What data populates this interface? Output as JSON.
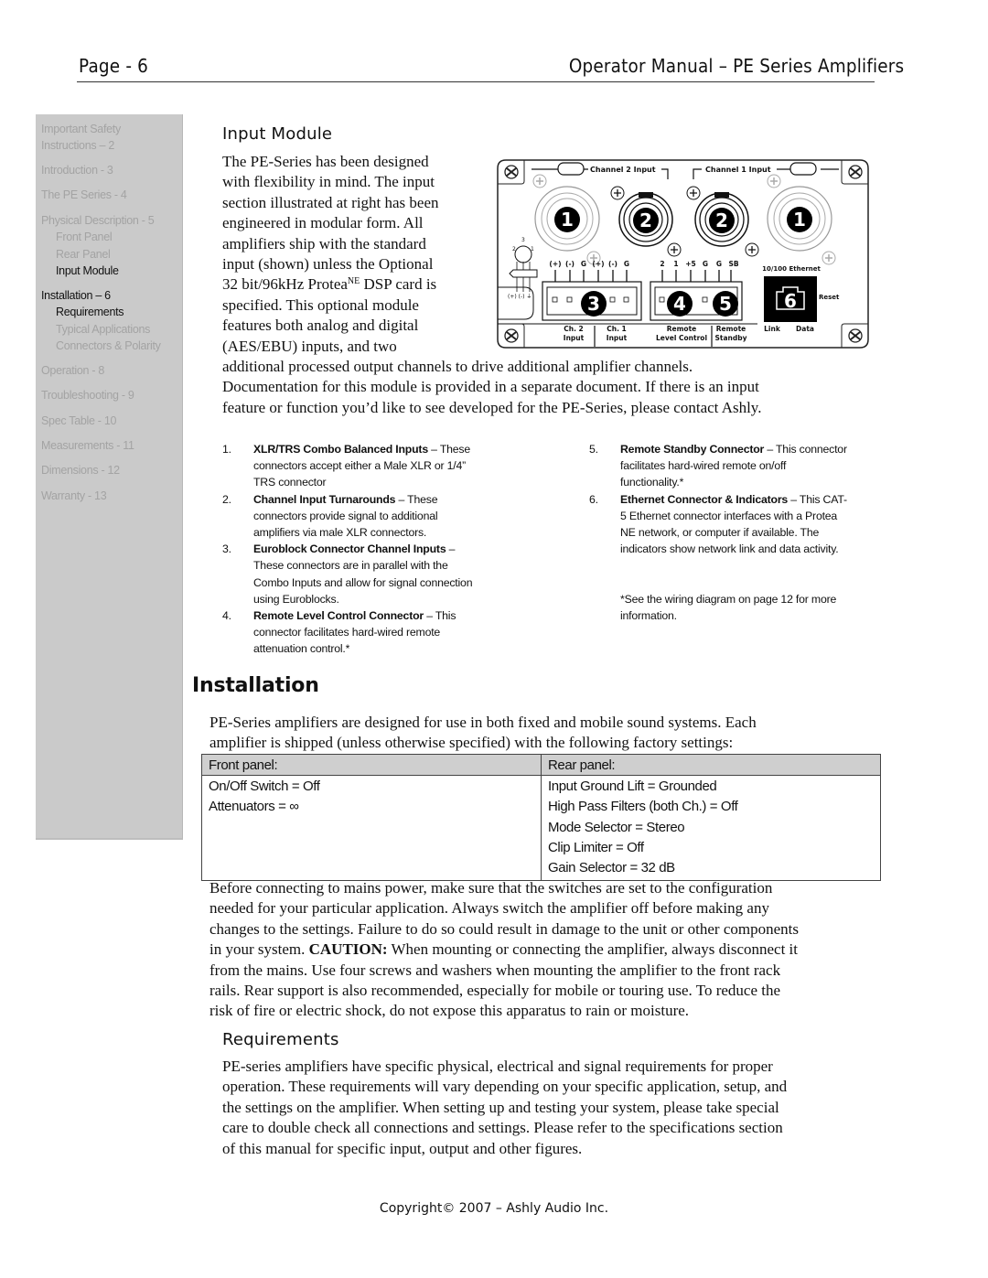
{
  "header": {
    "page_label": "Page - 6",
    "manual_title": "Operator Manual – PE Series Amplifiers"
  },
  "sidebar": {
    "items": [
      {
        "label": "Important Safety",
        "level": 0,
        "active": false
      },
      {
        "label": "Instructions – 2",
        "level": 0,
        "active": false
      },
      {
        "label": "Introduction - 3",
        "level": 0,
        "active": false
      },
      {
        "label": "The PE Series - 4",
        "level": 0,
        "active": false
      },
      {
        "label": "Physical Description - 5",
        "level": 0,
        "active": false
      },
      {
        "label": "Front Panel",
        "level": 1,
        "active": false
      },
      {
        "label": "Rear Panel",
        "level": 1,
        "active": false
      },
      {
        "label": "Input Module",
        "level": 1,
        "active": true
      },
      {
        "label": "Installation – 6",
        "level": 0,
        "active": true
      },
      {
        "label": "Requirements",
        "level": 1,
        "active": true
      },
      {
        "label": "Typical Applications",
        "level": 1,
        "active": false
      },
      {
        "label": "Connectors & Polarity",
        "level": 1,
        "active": false
      },
      {
        "label": "Operation - 8",
        "level": 0,
        "active": false
      },
      {
        "label": "Troubleshooting - 9",
        "level": 0,
        "active": false
      },
      {
        "label": "Spec Table - 10",
        "level": 0,
        "active": false
      },
      {
        "label": "Measurements - 11",
        "level": 0,
        "active": false
      },
      {
        "label": "Dimensions - 12",
        "level": 0,
        "active": false
      },
      {
        "label": "Warranty - 13",
        "level": 0,
        "active": false
      }
    ]
  },
  "input_module": {
    "heading": "Input Module",
    "intro_lines": [
      "The PE-Series has been designed",
      "with flexibility in mind.  The input",
      "section illustrated at right has been",
      "engineered in modular form.  All",
      "amplifiers ship with the standard",
      "input (shown) unless the Optional",
      "32 bit/96kHz Protea",
      "specified. This optional module",
      "features both analog and digital",
      "(AES/EBU) inputs, and two"
    ],
    "protea_superscript": "NE",
    "protea_suffix": " DSP card is",
    "continuation_lines": [
      "additional processed output channels to drive additional amplifier channels.",
      "Documentation for this module is provided in a separate document.  If there is an input",
      "feature or function you’d like to see developed for the PE-Series, please contact Ashly."
    ],
    "diagram": {
      "channel2_label": "Channel 2 Input",
      "channel1_label": "Channel 1 Input",
      "callouts": [
        "1",
        "2",
        "2",
        "1",
        "3",
        "4",
        "5",
        "6"
      ],
      "trs_pins": [
        "3",
        "2",
        "1"
      ],
      "trs_legend": "(+) (-) ⏚",
      "euro_pins": [
        "(+)",
        "(-)",
        "G",
        "(+)",
        "(-)",
        "G"
      ],
      "remote_pins": [
        "2",
        "1",
        "+5",
        "G",
        "G",
        "SB"
      ],
      "ethernet_label": "10/100 Ethernet",
      "reset_label": "Reset",
      "bottom_labels": {
        "ch2_input": [
          "Ch. 2",
          "Input"
        ],
        "ch1_input": [
          "Ch. 1",
          "Input"
        ],
        "remote_level": [
          "Remote",
          "Level Control"
        ],
        "remote_standby": [
          "Remote",
          "Standby"
        ],
        "link": "Link",
        "data": "Data"
      }
    },
    "features_left": [
      {
        "num": "1.",
        "title": "XLR/TRS Combo Balanced Inputs",
        "lines": [
          " – These",
          "connectors accept either a Male XLR or 1/4”",
          "TRS connector"
        ]
      },
      {
        "num": "2.",
        "title": "Channel Input Turnarounds",
        "lines": [
          " – These",
          "connectors provide signal to additional",
          "amplifiers via male XLR connectors."
        ]
      },
      {
        "num": "3.",
        "title": "Euroblock Connector Channel Inputs",
        "lines": [
          " –",
          "These connectors are in parallel with the",
          "Combo Inputs and allow for signal connection",
          "using Euroblocks."
        ]
      },
      {
        "num": "4.",
        "title": "Remote Level Control Connector",
        "lines": [
          " – This",
          "connector facilitates hard-wired remote",
          "attenuation control.*"
        ]
      }
    ],
    "features_right": [
      {
        "num": "5.",
        "title": "Remote Standby Connector",
        "lines": [
          " – This connector",
          "facilitates hard-wired remote on/off",
          "functionality.*"
        ]
      },
      {
        "num": "6.",
        "title": "Ethernet Connector & Indicators",
        "lines": [
          " – This CAT-",
          "5 Ethernet connector interfaces with a Protea",
          "NE network, or computer if available.  The",
          "indicators show network link and data activity."
        ]
      }
    ],
    "footnote_lines": [
      "*See the wiring diagram on page 12 for more",
      "information."
    ]
  },
  "installation": {
    "heading": "Installation",
    "intro_lines": [
      "PE-Series amplifiers are designed for use in both fixed and mobile sound systems.  Each",
      "amplifier is shipped (unless otherwise specified) with the following factory settings:"
    ],
    "settings_table": {
      "headers": [
        "Front panel:",
        "Rear panel:"
      ],
      "front": [
        "On/Off Switch = Off",
        "Attenuators = ∞"
      ],
      "rear": [
        "Input Ground Lift = Grounded",
        "High Pass Filters (both Ch.) = Off",
        "Mode Selector = Stereo",
        "Clip Limiter = Off",
        "Gain Selector = 32 dB"
      ]
    },
    "caution_lines": [
      "Before connecting to mains power, make sure that the switches are set to the configuration",
      "needed for your particular application. Always switch the amplifier off before making any",
      "changes to the settings.  Failure to do so could result in damage to the unit or other components",
      "in your system.  ",
      "from the mains.  Use four screws and washers when mounting the amplifier to the front rack",
      "rails.  Rear support is also recommended, especially for mobile or touring use. To reduce the",
      "risk of fire or electric shock, do not expose this apparatus to rain or moisture."
    ],
    "caution_label": "CAUTION:",
    "caution_after": " When mounting or connecting the amplifier, always disconnect it"
  },
  "requirements": {
    "heading": "Requirements",
    "lines": [
      "PE-series amplifiers have specific physical, electrical and signal requirements for proper",
      "operation.  These requirements will vary depending on your specific application, setup, and",
      "the settings on the amplifier.  When setting up and testing your system, please take special",
      "care to double check all connections and settings.  Please refer to the specifications section",
      "of this manual for specific input, output and other figures."
    ]
  },
  "footer": {
    "copyright": "Copyright© 2007 – Ashly Audio Inc."
  }
}
